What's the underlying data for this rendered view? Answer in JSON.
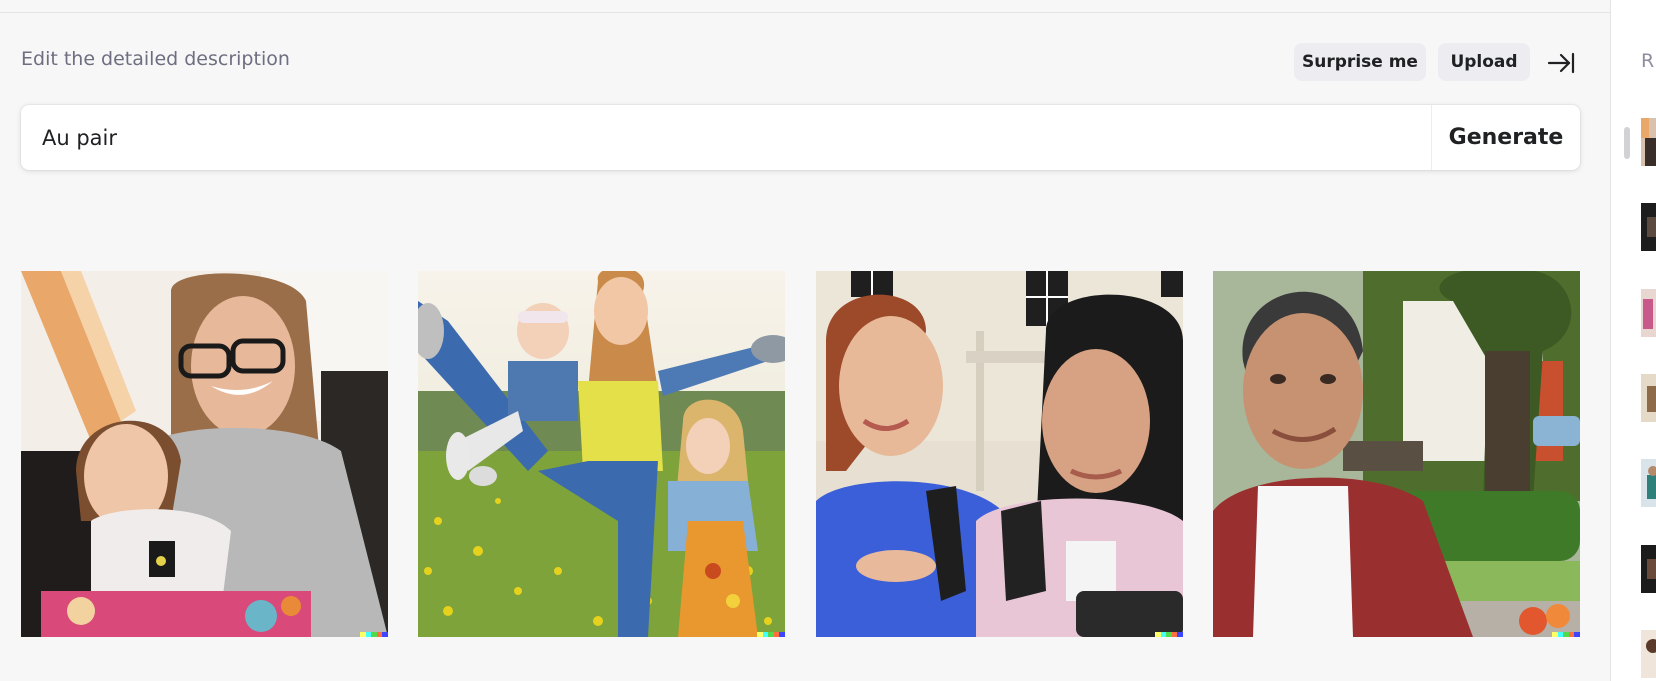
{
  "header": {
    "description_label": "Edit the detailed description",
    "surprise_label": "Surprise me",
    "upload_label": "Upload"
  },
  "prompt": {
    "value": "Au pair",
    "generate_label": "Generate"
  },
  "results": [
    {
      "name": "result-image-1",
      "subject": "woman with glasses and young girl sitting indoors"
    },
    {
      "name": "result-image-2",
      "subject": "young woman with two children in a flower meadow"
    },
    {
      "name": "result-image-3",
      "subject": "two young women talking outdoors"
    },
    {
      "name": "result-image-4",
      "subject": "smiling man in red shirt in a park"
    }
  ],
  "sidebar": {
    "heading_initial": "R"
  },
  "colors": {
    "background": "#f7f7f8",
    "pill": "#ececf1",
    "text": "#202123",
    "muted": "#6e6e80"
  },
  "icons": [
    "collapse-sidebar-icon"
  ]
}
